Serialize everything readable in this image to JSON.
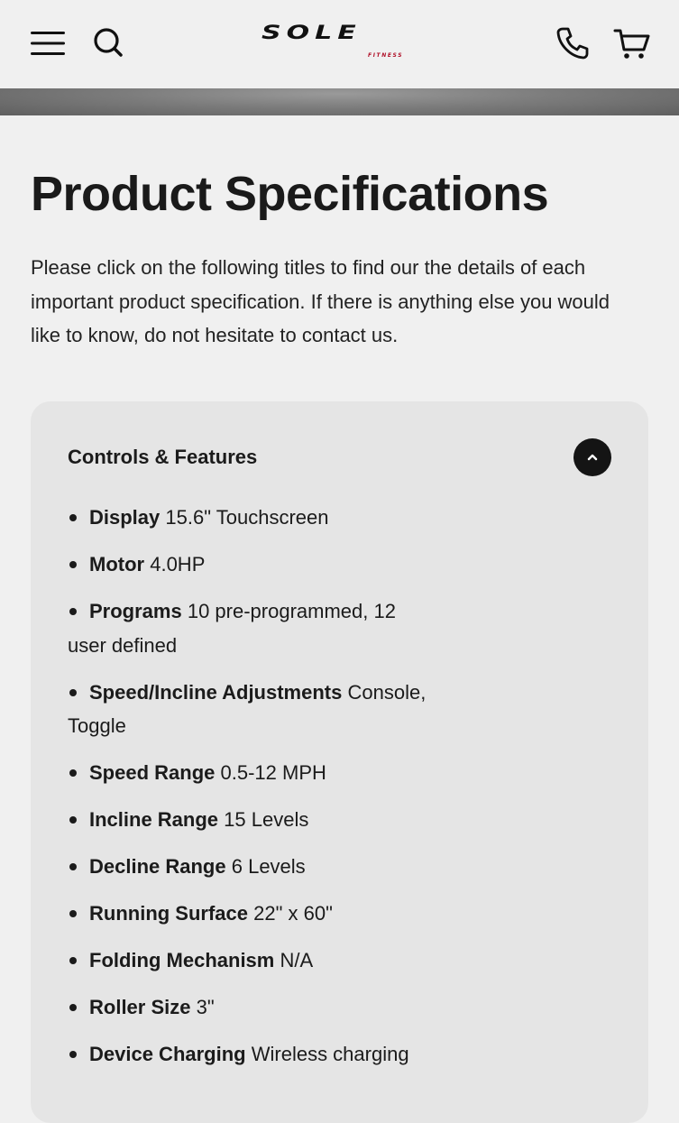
{
  "header": {
    "logo_text": "SOLE",
    "logo_subtext": "FITNESS",
    "menu_icon": "hamburger-menu-icon",
    "search_icon": "search-icon",
    "phone_icon": "phone-icon",
    "cart_icon": "cart-icon"
  },
  "page": {
    "title": "Product Specifications",
    "intro": "Please click on the following titles to find our the details of each important product specification. If there is anything else you would like to know, do not hesitate to contact us."
  },
  "accordion": {
    "title": "Controls & Features",
    "expanded": true,
    "toggle_icon": "chevron-up-icon",
    "items": [
      {
        "label": "Display",
        "value": "15.6\" Touchscreen"
      },
      {
        "label": "Motor",
        "value": "4.0HP"
      },
      {
        "label": "Programs",
        "value": "10 pre-programmed, 12 user defined"
      },
      {
        "label": "Speed/Incline Adjustments",
        "value": "Console, Toggle"
      },
      {
        "label": "Speed Range",
        "value": "0.5-12 MPH"
      },
      {
        "label": "Incline Range",
        "value": "15 Levels"
      },
      {
        "label": "Decline Range",
        "value": "6 Levels"
      },
      {
        "label": "Running Surface",
        "value": "22\" x 60\""
      },
      {
        "label": "Folding Mechanism",
        "value": "N/A"
      },
      {
        "label": "Roller Size",
        "value": "3\""
      },
      {
        "label": "Device Charging",
        "value": "Wireless charging"
      }
    ]
  },
  "colors": {
    "background": "#f0f0f0",
    "card_background": "#e5e5e5",
    "text": "#1b1b1b",
    "brand_accent": "#b0122a",
    "toggle_button": "#141414"
  }
}
